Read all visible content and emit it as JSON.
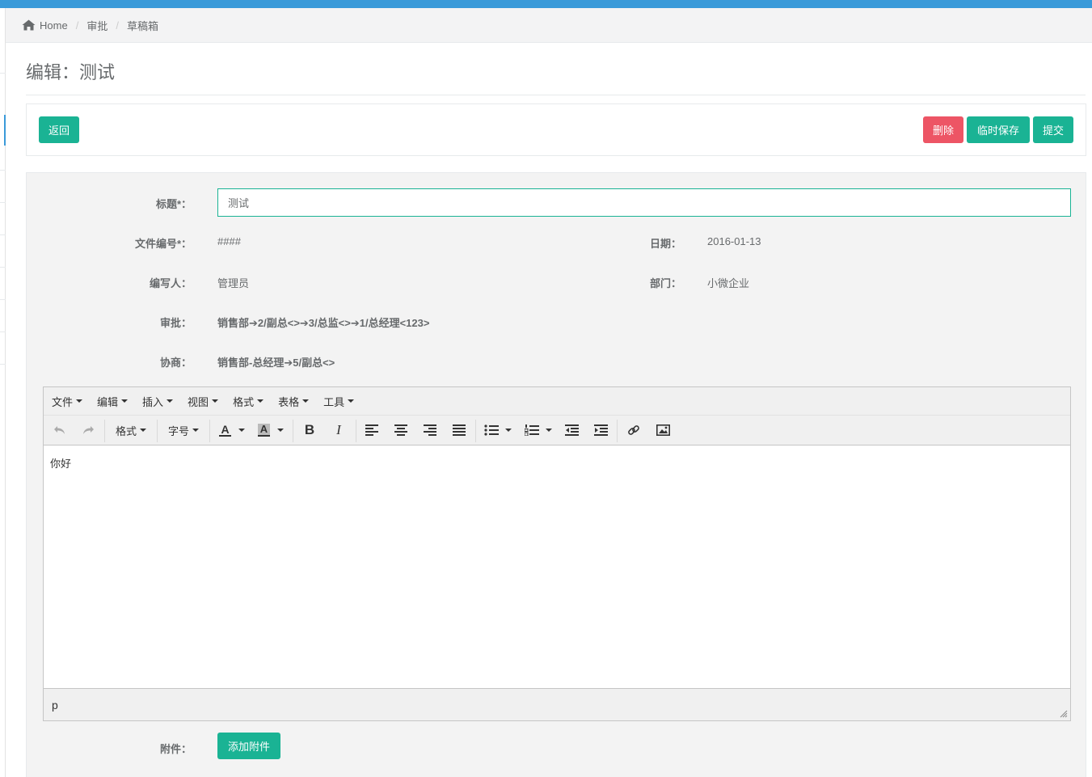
{
  "breadcrumb": {
    "home": "Home",
    "items": [
      "审批",
      "草稿箱"
    ]
  },
  "page_title": "编辑：测试",
  "actions": {
    "back": "返回",
    "delete": "删除",
    "temp_save": "临时保存",
    "submit": "提交"
  },
  "form": {
    "title_label": "标题*：",
    "title_value": "测试",
    "docno_label": "文件编号*：",
    "docno_value": "####",
    "date_label": "日期：",
    "date_value": "2016-01-13",
    "author_label": "编写人：",
    "author_value": "管理员",
    "dept_label": "部门：",
    "dept_value": "小微企业",
    "approval_label": "审批：",
    "approval_value": "销售部➔2/副总<>➔3/总监<>➔1/总经理<123>",
    "consult_label": "协商：",
    "consult_value": "销售部-总经理➔5/副总<>",
    "attach_label": "附件：",
    "attach_button": "添加附件"
  },
  "editor": {
    "menus": [
      "文件",
      "编辑",
      "插入",
      "视图",
      "格式",
      "表格",
      "工具"
    ],
    "format_select": "格式",
    "fontsize_select": "字号",
    "text_color_glyph": "A",
    "bg_color_glyph": "A",
    "bold_glyph": "B",
    "italic_glyph": "I",
    "content": "你好",
    "status_path": "p"
  },
  "colors": {
    "primary": "#1ab394",
    "danger": "#ed5565",
    "topbar": "#3a9ad9"
  }
}
